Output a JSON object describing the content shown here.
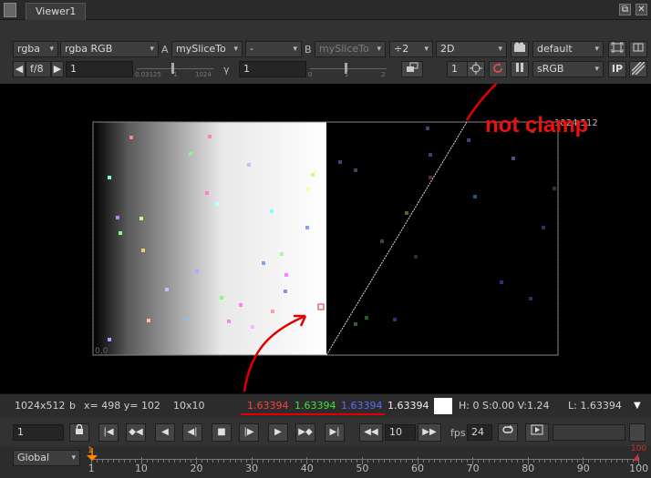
{
  "tab": {
    "title": "Viewer1",
    "float_icon": "⧉",
    "close_icon": "✕"
  },
  "toolbar1": {
    "layer": "rgba",
    "channels": "rgba RGB",
    "input_a_label": "A",
    "input_a": "mySliceTo",
    "composite": "-",
    "input_b_label": "B",
    "input_b": "mySliceTo",
    "downscale": "÷2",
    "view_mode": "2D",
    "lut": "default"
  },
  "toolbar2": {
    "fstop": "f/8",
    "gain": "1",
    "gain_slider_ticks": [
      "0.03125",
      "1",
      "1024"
    ],
    "gamma_label": "γ",
    "gamma": "1",
    "gamma_slider_ticks": [
      "0",
      "1",
      "2"
    ],
    "frame_inc": "1",
    "colorspace": "sRGB",
    "ip_label": "IP"
  },
  "viewer": {
    "format_label": "1024,512",
    "origin_label": "0,0",
    "annotation": "not clamp"
  },
  "infobar": {
    "format": "1024x512",
    "bbox_flag": "b",
    "cursor": "x= 498 y= 102",
    "sample_size": "10x10",
    "r": "1.63394",
    "g": "1.63394",
    "b": "1.63394",
    "a": "1.63394",
    "hsv": "H:  0 S:0.00 V:1.24",
    "luma": "L: 1.63394",
    "colors": {
      "r": "#ff4040",
      "g": "#40e040",
      "b": "#5a6bff"
    }
  },
  "transport": {
    "frame": "1",
    "increment": "10",
    "fps_label": "fps",
    "fps": "24"
  },
  "timeline": {
    "range_mode": "Global",
    "labels": [
      "1",
      "10",
      "20",
      "30",
      "40",
      "50",
      "60",
      "70",
      "80",
      "90",
      "100"
    ],
    "in_frame": "1",
    "out_frame": "100"
  },
  "noise_pixels": [
    [
      142,
      149,
      "#ff8080"
    ],
    [
      207,
      167,
      "#80ff80"
    ],
    [
      228,
      148,
      "#ff80c0"
    ],
    [
      271,
      179,
      "#c0c0ff"
    ],
    [
      341,
      190,
      "#c0ff80"
    ],
    [
      118,
      193,
      "#80ffc0"
    ],
    [
      127,
      237,
      "#c080ff"
    ],
    [
      155,
      273,
      "#ffc080"
    ],
    [
      214,
      296,
      "#c0a0ff"
    ],
    [
      241,
      325,
      "#80ff80"
    ],
    [
      262,
      333,
      "#ff80ff"
    ],
    [
      297,
      340,
      "#ffa0a0"
    ],
    [
      311,
      318,
      "#a080ff"
    ],
    [
      201,
      349,
      "#80c0ff"
    ],
    [
      249,
      351,
      "#ff80ff"
    ],
    [
      161,
      350,
      "#ffc0a0"
    ],
    [
      275,
      357,
      "#ffb0ff"
    ],
    [
      118,
      371,
      "#a0a0ff"
    ],
    [
      312,
      300,
      "#ff80ff"
    ],
    [
      307,
      277,
      "#a0ffa0"
    ],
    [
      287,
      287,
      "#80a0ff"
    ],
    [
      335,
      248,
      "#80a0ff"
    ],
    [
      296,
      230,
      "#80ffff"
    ],
    [
      236,
      222,
      "#c0ffff"
    ],
    [
      130,
      254,
      "#80ff80"
    ],
    [
      181,
      316,
      "#c0c0ff"
    ],
    [
      225,
      210,
      "#ff80c0"
    ],
    [
      344,
      186,
      "#ffffc0"
    ],
    [
      335,
      206,
      "#ffff80"
    ],
    [
      153,
      238,
      "#c0ff80"
    ],
    [
      371,
      176,
      "#404080"
    ],
    [
      388,
      185,
      "#404060"
    ],
    [
      417,
      263,
      "#305030"
    ],
    [
      444,
      232,
      "#606030"
    ],
    [
      467,
      139,
      "#404080"
    ],
    [
      470,
      193,
      "#503030"
    ],
    [
      512,
      152,
      "#404080"
    ],
    [
      519,
      214,
      "#305080"
    ],
    [
      548,
      308,
      "#303080"
    ],
    [
      582,
      142,
      "#406040"
    ],
    [
      594,
      248,
      "#303060"
    ],
    [
      580,
      326,
      "#303060"
    ],
    [
      431,
      349,
      "#303080"
    ],
    [
      454,
      280,
      "#402040"
    ],
    [
      400,
      347,
      "#206020"
    ],
    [
      388,
      354,
      "#306030"
    ],
    [
      561,
      172,
      "#505080"
    ],
    [
      470,
      168,
      "#404080"
    ],
    [
      606,
      205,
      "#303060"
    ]
  ]
}
